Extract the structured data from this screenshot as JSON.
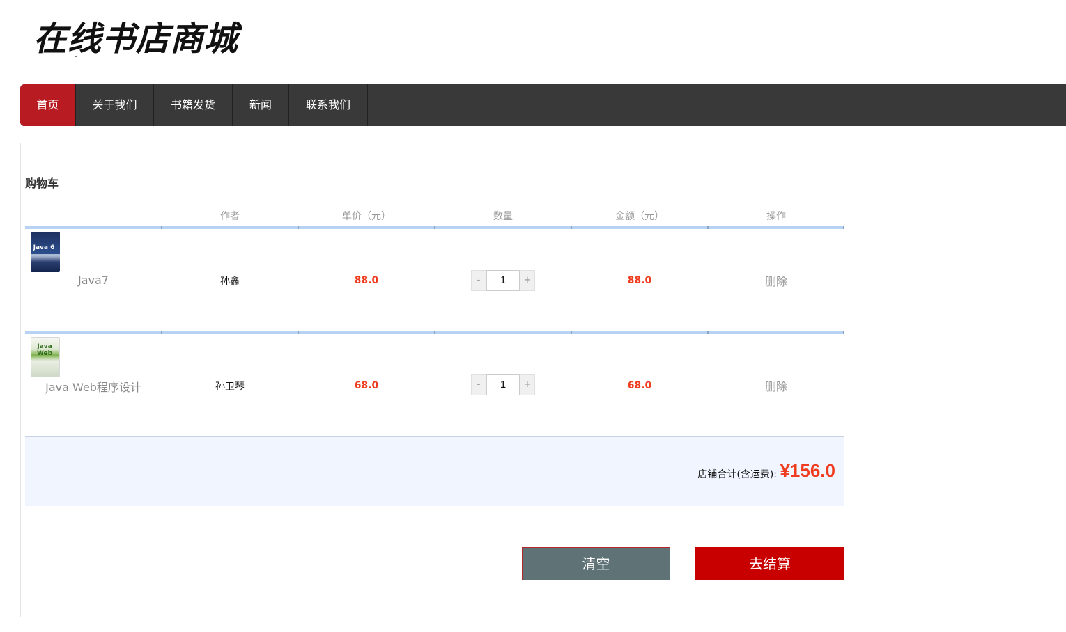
{
  "logo": {
    "text": "在线书店商城"
  },
  "nav": {
    "items": [
      {
        "label": "首页",
        "active": true
      },
      {
        "label": "关于我们"
      },
      {
        "label": "书籍发货"
      },
      {
        "label": "新闻"
      },
      {
        "label": "联系我们"
      }
    ]
  },
  "cart": {
    "title": "购物车",
    "columns": [
      "",
      "作者",
      "单价（元）",
      "数量",
      "金额（元）",
      "操作"
    ],
    "items": [
      {
        "name": "Java7",
        "author": "孙鑫",
        "price": "88.0",
        "quantity": "1",
        "amount": "88.0",
        "action": "删除",
        "cover_label": "Java 6"
      },
      {
        "name": "Java Web程序设计",
        "author": "孙卫琴",
        "price": "68.0",
        "quantity": "1",
        "amount": "68.0",
        "action": "删除",
        "cover_label": "Java Web"
      }
    ],
    "minus": "-",
    "plus": "+",
    "total_label": "店铺合计(含运费):",
    "total_value": "¥156.0",
    "clear_label": "清空",
    "checkout_label": "去结算"
  },
  "colors": {
    "nav_bg": "#393939",
    "nav_active": "#b81c22",
    "price": "#f03c1e",
    "checkout": "#c80000",
    "clear": "#5f7276",
    "table_line": "#b7d2f2",
    "total_bg": "#f0f5ff"
  }
}
